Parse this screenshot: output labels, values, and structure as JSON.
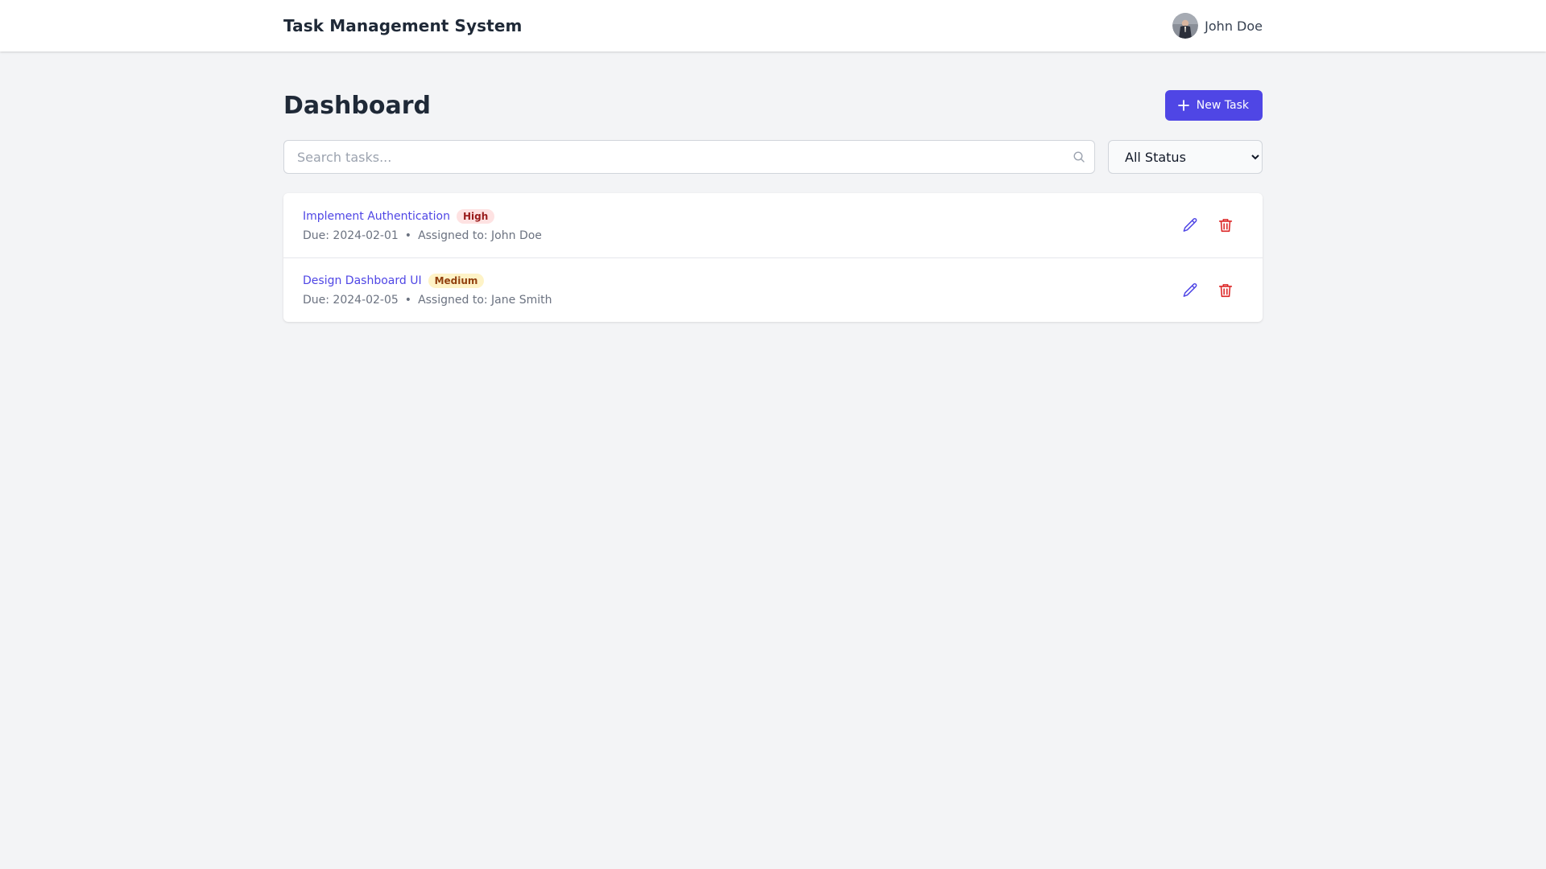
{
  "header": {
    "app_title": "Task Management System",
    "user_name": "John Doe"
  },
  "main": {
    "page_title": "Dashboard",
    "new_task_label": "New Task"
  },
  "filters": {
    "search_placeholder": "Search tasks...",
    "search_value": "",
    "status_selected": "All Status"
  },
  "tasks": [
    {
      "title": "Implement Authentication",
      "priority": "High",
      "priority_bg": "#fee2e2",
      "priority_color": "#991b1b",
      "due": "Due: 2024-02-01",
      "separator": "•",
      "assigned": "Assigned to: John Doe"
    },
    {
      "title": "Design Dashboard UI",
      "priority": "Medium",
      "priority_bg": "#fef3c7",
      "priority_color": "#92400e",
      "due": "Due: 2024-02-05",
      "separator": "•",
      "assigned": "Assigned to: Jane Smith"
    }
  ],
  "colors": {
    "accent": "#4f46e5",
    "danger": "#dc2626",
    "background": "#f3f4f6"
  },
  "icons": {
    "new_task": "plus-icon",
    "search": "search-icon",
    "edit": "pencil-icon",
    "delete": "trash-icon"
  }
}
